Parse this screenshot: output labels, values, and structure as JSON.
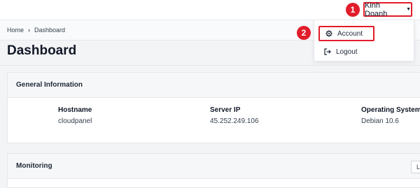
{
  "user_menu": {
    "name": "Kinh Doanh"
  },
  "steps": [
    "1",
    "2"
  ],
  "breadcrumb": {
    "home": "Home",
    "current": "Dashboard"
  },
  "page": {
    "title": "Dashboard"
  },
  "general": {
    "title": "General Information",
    "fields": [
      {
        "label": "Hostname",
        "value": "cloudpanel"
      },
      {
        "label": "Server IP",
        "value": "45.252.249.106"
      },
      {
        "label": "Operating System",
        "value": "Debian 10.6"
      }
    ]
  },
  "monitoring": {
    "title": "Monitoring",
    "range_button": "La"
  },
  "dropdown": {
    "items": [
      {
        "label": "Account",
        "icon": "gear-icon"
      },
      {
        "label": "Logout",
        "icon": "logout-icon"
      }
    ]
  },
  "colors": {
    "highlight": "#e11d2a"
  }
}
